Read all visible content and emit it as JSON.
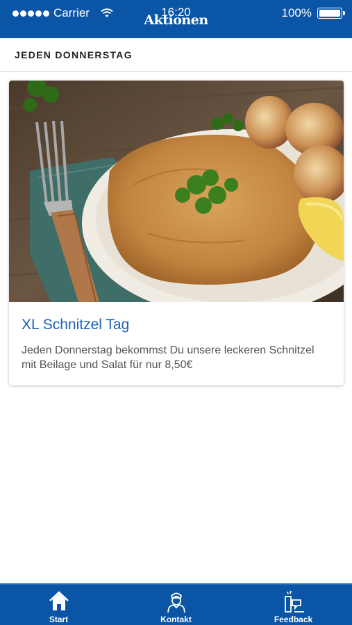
{
  "status_bar": {
    "carrier": "Carrier",
    "time": "16:20",
    "battery": "100%"
  },
  "header": {
    "title": "Aktionen"
  },
  "section": {
    "heading": "JEDEN DONNERSTAG"
  },
  "card": {
    "title": "XL Schnitzel Tag",
    "description": "Jeden Donnerstag bekommst Du unsere leckeren Schnitzel mit Beilage und Salat für nur 8,50€"
  },
  "tabs": [
    {
      "label": "Start",
      "icon": "home-icon"
    },
    {
      "label": "Kontakt",
      "icon": "waiter-icon"
    },
    {
      "label": "Feedback",
      "icon": "feedback-icon"
    }
  ],
  "colors": {
    "brand": "#0a55a5",
    "title": "#1b63b3"
  }
}
